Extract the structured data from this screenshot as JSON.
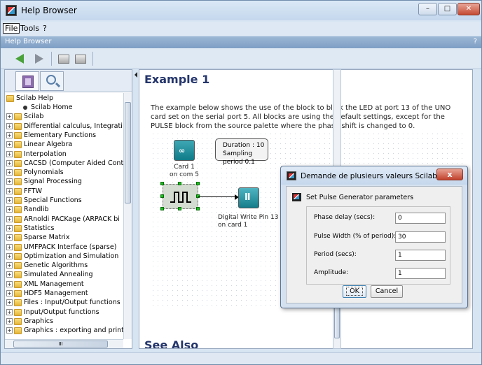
{
  "window": {
    "title": "Help Browser"
  },
  "menubar": {
    "items": [
      "File",
      "Tools",
      "?"
    ]
  },
  "subtitle": {
    "text": "Help Browser",
    "help": "?"
  },
  "tree": {
    "root": "Scilab Help",
    "items": [
      "Scilab Home",
      "Scilab",
      "Differential calculus, Integrati",
      "Elementary Functions",
      "Linear Algebra",
      "Interpolation",
      "CACSD (Computer Aided Cont",
      "Polynomials",
      "Signal Processing",
      "FFTW",
      "Special Functions",
      "Randlib",
      "ARnoldi PACKage (ARPACK bi",
      "Statistics",
      "Sparse Matrix",
      "UMFPACK Interface (sparse)",
      "Optimization and Simulation",
      "Genetic Algorithms",
      "Simulated Annealing",
      "XML Management",
      "HDF5 Management",
      "Files : Input/Output functions",
      "Input/Output functions",
      "Graphics",
      "Graphics : exporting and print"
    ],
    "hscroll_label": "III"
  },
  "content": {
    "heading": "Example 1",
    "paragraph": "The example below shows the use of the block to blink the LED at port 13 of the UNO card set on the serial port 5. All blocks are using the default settings, except for the PULSE block from the source palette where the phase shift is changed to 0.",
    "see_also": "See Also"
  },
  "diagram": {
    "card_label_1": "Card 1",
    "card_label_2": "on com 5",
    "note_line_1": "Duration : 10",
    "note_line_2": "Sampling period 0.1",
    "dwp_label_1": "Digital Write Pin 13",
    "dwp_label_2": "on card 1"
  },
  "dialog": {
    "title": "Demande de plusieurs valeurs Scilab",
    "close_label": "x",
    "header": "Set Pulse Generator parameters",
    "fields": [
      {
        "label": "Phase delay (secs):",
        "value": "0"
      },
      {
        "label": "Pulse Width (% of period):",
        "value": "30"
      },
      {
        "label": "Period (secs):",
        "value": "1"
      },
      {
        "label": "Amplitude:",
        "value": "1"
      }
    ],
    "ok_label": "OK",
    "cancel_label": "Cancel"
  }
}
